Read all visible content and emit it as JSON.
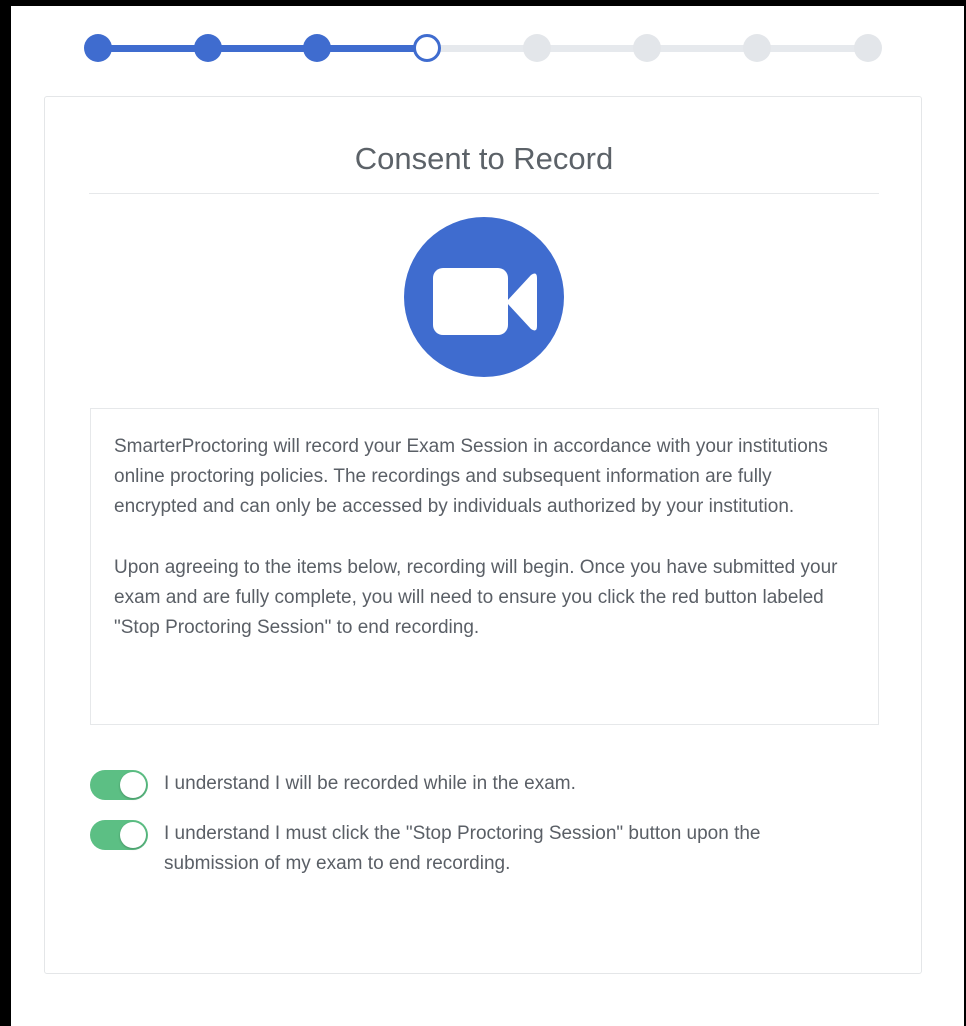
{
  "stepper": {
    "steps": [
      {
        "status": "complete"
      },
      {
        "status": "complete"
      },
      {
        "status": "complete"
      },
      {
        "status": "current"
      },
      {
        "status": "pending"
      },
      {
        "status": "pending"
      },
      {
        "status": "pending"
      },
      {
        "status": "pending"
      }
    ],
    "current_step": 4,
    "total_steps": 8
  },
  "card": {
    "title": "Consent to Record",
    "icon": "video-camera-icon",
    "body": {
      "paragraph1": "SmarterProctoring will record your Exam Session in accordance with your institutions online proctoring policies. The recordings and subsequent information are fully encrypted and can only be accessed by individuals authorized by your institution.",
      "paragraph2": "Upon agreeing to the items below, recording will begin. Once you have submitted your exam and are fully complete, you will need to ensure you click the red button labeled \"Stop Proctoring Session\" to end recording."
    },
    "consents": [
      {
        "label": "I understand I will be recorded while in the exam.",
        "checked": true
      },
      {
        "label": "I understand I must click the \"Stop Proctoring Session\" button upon the submission of my exam to end recording.",
        "checked": true
      }
    ]
  },
  "colors": {
    "accent": "#3f6ccf",
    "toggle_on": "#5cbf84",
    "step_pending": "#e3e6ea",
    "text": "#5a5f66"
  }
}
